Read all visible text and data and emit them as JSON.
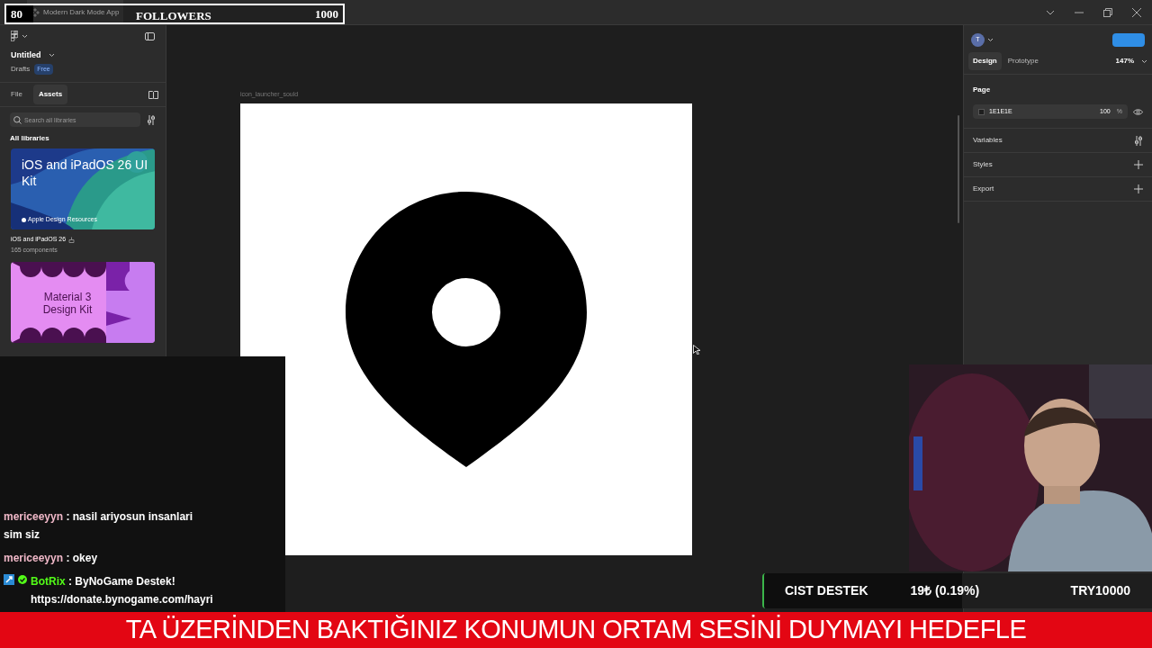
{
  "title_bar": {
    "tab": "Modern Dark Mode App"
  },
  "followers_goal": {
    "count": "80",
    "label": "FOLLOWERS",
    "goal": "1000",
    "level": 0.08
  },
  "left_panel": {
    "file_name": "Untitled",
    "location": "Drafts",
    "plan_badge": "Free",
    "tabs": [
      {
        "label": "File",
        "selected": false
      },
      {
        "label": "Assets",
        "selected": true
      }
    ],
    "search": {
      "placeholder": "Search all libraries"
    },
    "section": "All libraries",
    "libraries": [
      {
        "kind": "ios",
        "thumb_title": "iOS and iPadOS 26 UI Kit",
        "thumb_caption": "Apple Design Resources",
        "name": "iOS and iPadOS 26",
        "count": "165 components"
      },
      {
        "kind": "material",
        "thumb_title": "Material 3 Design Kit"
      }
    ]
  },
  "canvas": {
    "frame_label": "icon_launcher_sould"
  },
  "right_panel": {
    "avatar": "T",
    "tabs": [
      {
        "label": "Design",
        "selected": true
      },
      {
        "label": "Prototype",
        "selected": false
      }
    ],
    "zoom": "147%",
    "page": {
      "title": "Page",
      "fill": "1E1E1E",
      "color": "#1e1e1e",
      "opacity": "100",
      "unit": "%"
    },
    "sections": [
      {
        "label": "Variables",
        "kind": "adjust"
      },
      {
        "label": "Styles",
        "kind": "add"
      },
      {
        "label": "Export",
        "kind": "add"
      }
    ]
  },
  "chat": [
    {
      "user": "mericeeyyn",
      "color": "#f0b8c8",
      "text": ": nasil ariyosun insanlari sim siz",
      "bot": false
    },
    {
      "user": "mericeeyyn",
      "color": "#f0b8c8",
      "text": ": okey",
      "bot": false
    },
    {
      "user": "BotRix",
      "color": "#53fc18",
      "text": ": ByNoGame Destek! https://donate.bynogame.com/hayri",
      "bot": true
    }
  ],
  "donation_bar": {
    "label": "CIST DESTEK",
    "amount": "19₺ (0.19%)",
    "goal": "TRY10000",
    "level": 0.51
  },
  "ticker": "TA ÜZERİNDEN BAKTIĞINIZ KONUMUN ORTAM SESİNİ DUYMAYI HEDEFLE"
}
